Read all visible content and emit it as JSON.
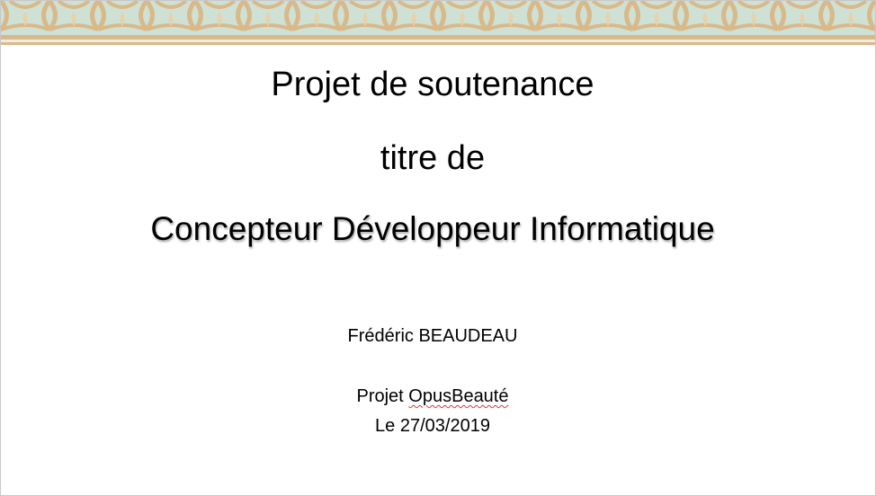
{
  "slide": {
    "title_line_1": "Projet de soutenance",
    "title_line_2": "titre de",
    "title_line_3": "Concepteur Développeur Informatique",
    "author": "Frédéric BEAUDEAU",
    "project_prefix": "Projet ",
    "project_name": "OpusBeauté",
    "date": "Le 27/03/2019"
  },
  "colors": {
    "border_tile": "#cfe1d4",
    "border_gold": "#d8b98a",
    "text": "#000000",
    "spellcheck": "#d33a3a"
  }
}
